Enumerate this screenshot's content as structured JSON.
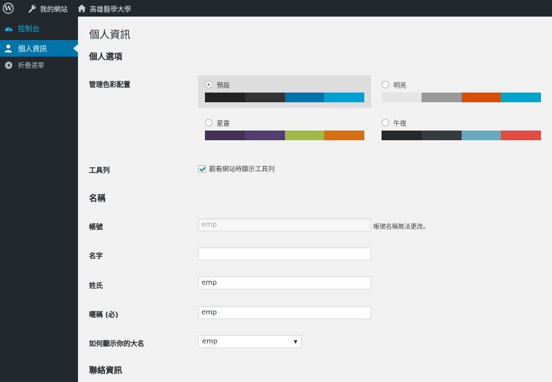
{
  "adminbar": {
    "site_item": "我的網站",
    "home_item": "高雄醫學大學"
  },
  "sidebar": {
    "dashboard": "控制台",
    "profile": "個人資訊",
    "collapse": "折疊選單"
  },
  "page": {
    "title": "個人資訊",
    "personal_options": "個人選項",
    "color_scheme_label": "管理色彩配置",
    "schemes": [
      {
        "name": "預設",
        "selected": true,
        "colors": [
          "#222222",
          "#333333",
          "#0073aa",
          "#00a0d2"
        ]
      },
      {
        "name": "明亮",
        "selected": false,
        "colors": [
          "#e5e5e5",
          "#999999",
          "#d64e07",
          "#04a4cc"
        ]
      },
      {
        "name": "星靈",
        "selected": false,
        "colors": [
          "#413256",
          "#523f6d",
          "#a3b745",
          "#d46f15"
        ]
      },
      {
        "name": "午夜",
        "selected": false,
        "colors": [
          "#25282b",
          "#363b3f",
          "#69a8bb",
          "#e14d43"
        ]
      }
    ],
    "toolbar_label": "工具列",
    "toolbar_checkbox": "觀看網站時顯示工具列",
    "name_section": "名稱",
    "username_label": "帳號",
    "username_value": "emp",
    "username_desc": "帳號名稱無法更改。",
    "firstname_label": "名字",
    "firstname_value": "",
    "lastname_label": "姓氏",
    "lastname_value": "emp",
    "nickname_label": "暱稱 (必)",
    "nickname_value": "emp",
    "display_label": "如何顯示你的大名",
    "display_value": "emp",
    "contact_section": "聯絡資訊"
  }
}
